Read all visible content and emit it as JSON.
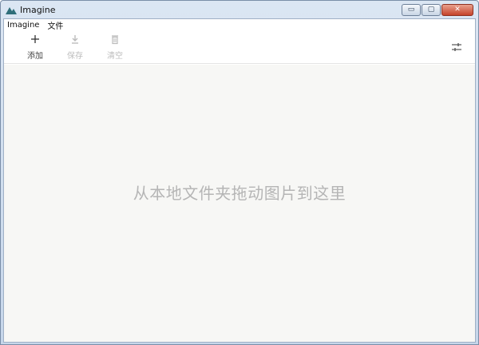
{
  "window": {
    "title": "Imagine",
    "controls": {
      "minimize": "▭",
      "maximize": "▢",
      "close": "✕"
    }
  },
  "menubar": {
    "items": [
      "Imagine",
      "文件"
    ]
  },
  "toolbar": {
    "add": {
      "label": "添加",
      "icon": "plus-icon"
    },
    "save": {
      "label": "保存",
      "icon": "download-icon"
    },
    "clear": {
      "label": "清空",
      "icon": "trash-icon"
    },
    "settings": {
      "icon": "sliders-icon"
    }
  },
  "dropzone": {
    "hint": "从本地文件夹拖动图片到这里"
  },
  "colors": {
    "titlebar": "#c6d6ea",
    "dropzone_bg": "#f7f7f5",
    "hint_text": "#b5b5b5",
    "disabled_text": "#bdbdbd"
  }
}
